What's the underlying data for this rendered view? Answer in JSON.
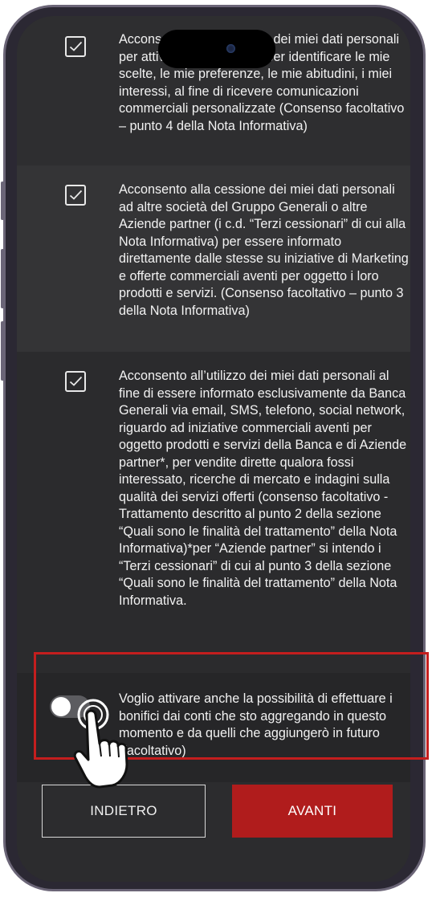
{
  "consents": [
    {
      "checked": true,
      "text": "Acconsento al trattamento dei miei dati personali per attività di profilazione per identificare le mie scelte, le mie preferenze, le mie abitudini, i miei interessi, al fine di ricevere comunicazioni commerciali personalizzate (Consenso facoltativo – punto 4 della Nota Informativa)"
    },
    {
      "checked": true,
      "text": "Acconsento alla cessione dei miei dati personali ad altre società del Gruppo Generali o altre Aziende partner (i c.d. “Terzi cessionari” di cui alla Nota Informativa) per essere informato direttamente dalle stesse su iniziative di Marketing e offerte commerciali aventi per oggetto i loro prodotti e servizi. (Consenso facoltativo – punto 3 della Nota Informativa)"
    },
    {
      "checked": true,
      "text": "Acconsento all’utilizzo dei miei dati personali al fine di essere informato esclusivamente da Banca Generali via email, SMS, telefono, social network, riguardo ad iniziative commerciali aventi per oggetto prodotti e servizi della Banca e di Aziende partner*, per vendite dirette qualora fossi interessato, ricerche di mercato e indagini sulla qualità dei servizi offerti (consenso facoltativo - Trattamento descritto al punto 2 della sezione “Quali sono le finalità del trattamento” della Nota Informativa)*per “Aziende partner” si intendo i “Terzi cessionari” di cui al punto 3 della sezione “Quali sono le finalità del trattamento” della Nota Informativa."
    }
  ],
  "transfer_option": {
    "enabled": false,
    "text": "Voglio attivare anche la possibilità di effettuare i bonifici dai conti che sto aggregando in questo momento e da quelli che aggiungerò in futuro (facoltativo)"
  },
  "buttons": {
    "back_label": "INDIETRO",
    "next_label": "AVANTI"
  },
  "colors": {
    "accent": "#b01c1c",
    "highlight": "#c41e1e",
    "background": "#2c2c2e"
  }
}
